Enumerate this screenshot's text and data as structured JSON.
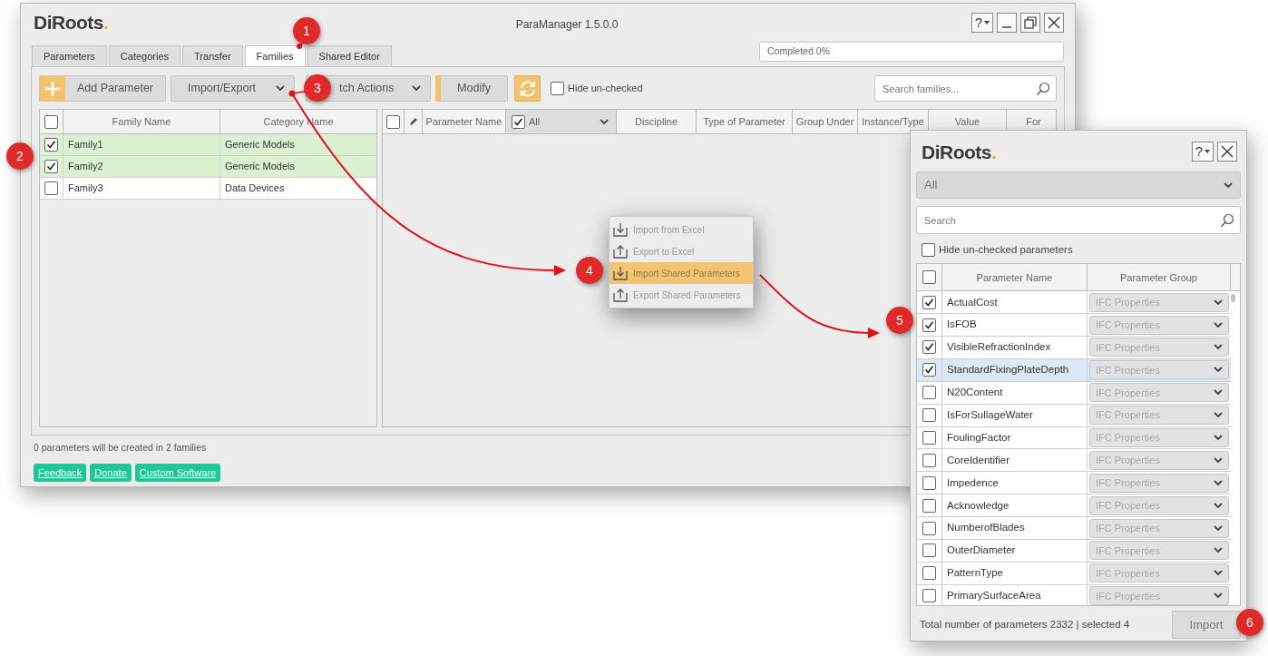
{
  "main_window": {
    "logo": "DiRoots.",
    "title": "ParaManager 1.5.0.0",
    "help_button": "?",
    "tabs": [
      {
        "label": "Parameters",
        "selected": false
      },
      {
        "label": "Categories",
        "selected": false
      },
      {
        "label": "Transfer",
        "selected": false
      },
      {
        "label": "Families",
        "selected": true
      },
      {
        "label": "Shared Editor",
        "selected": false
      }
    ],
    "progress": {
      "text": "Completed 0%",
      "level": 0
    },
    "toolbar": {
      "add_button": "Add Parameter",
      "import_export": "Import/Export",
      "batch_actions": "tch Actions",
      "modify": "Modify",
      "hide_unchecked": {
        "label": "Hide un-checked",
        "checked": false
      },
      "search": {
        "placeholder": "Search families..."
      }
    },
    "families_table": {
      "select_all": false,
      "columns": [
        "Family Name",
        "Category Name"
      ],
      "rows": [
        {
          "name": "Family1",
          "category": "Generic Models",
          "checked": true
        },
        {
          "name": "Family2",
          "category": "Generic Models",
          "checked": true
        },
        {
          "name": "Family3",
          "category": "Data Devices",
          "checked": false
        }
      ]
    },
    "parameters_table": {
      "select_all": false,
      "columns": [
        {
          "kind": "text",
          "label": "Parameter Name"
        },
        {
          "kind": "filter",
          "label": "All",
          "checked": true
        },
        {
          "kind": "text",
          "label": "Discipline"
        },
        {
          "kind": "text",
          "label": "Type of Parameter"
        },
        {
          "kind": "text",
          "label": "Group Under"
        },
        {
          "kind": "text",
          "label": "Instance/Type"
        },
        {
          "kind": "text",
          "label": "Value"
        },
        {
          "kind": "text",
          "label": "For"
        }
      ]
    },
    "status": "0 parameters will be created in 2 families",
    "links": [
      "Feedback",
      "Donate",
      "Custom Software"
    ]
  },
  "menu": {
    "items": [
      {
        "label": "Import from Excel",
        "kind": "import",
        "selected": false
      },
      {
        "label": "Export to Excel",
        "kind": "export",
        "selected": false
      },
      {
        "label": "Import Shared Parameters",
        "kind": "import",
        "selected": true
      },
      {
        "label": "Export Shared Parameters",
        "kind": "export",
        "selected": false
      }
    ]
  },
  "dialog": {
    "logo": "DiRoots.",
    "help_button": "?",
    "category": {
      "value": "All"
    },
    "search": {
      "placeholder": "Search"
    },
    "hide_unchecked": {
      "label": "Hide un-checked parameters",
      "checked": false
    },
    "table": {
      "select_all": false,
      "columns": [
        "Parameter Name",
        "Parameter Group"
      ],
      "rows": [
        {
          "name": "ActualCost",
          "group": "IFC Properties",
          "checked": true,
          "selected": false
        },
        {
          "name": "IsFOB",
          "group": "IFC Properties",
          "checked": true,
          "selected": false
        },
        {
          "name": "VisibleRefractionIndex",
          "group": "IFC Properties",
          "checked": true,
          "selected": false
        },
        {
          "name": "StandardFixingPlateDepth",
          "group": "IFC Properties",
          "checked": true,
          "selected": true
        },
        {
          "name": "N20Content",
          "group": "IFC Properties",
          "checked": false,
          "selected": false
        },
        {
          "name": "IsForSullageWater",
          "group": "IFC Properties",
          "checked": false,
          "selected": false
        },
        {
          "name": "FoulingFactor",
          "group": "IFC Properties",
          "checked": false,
          "selected": false
        },
        {
          "name": "CoreIdentifier",
          "group": "IFC Properties",
          "checked": false,
          "selected": false
        },
        {
          "name": "Impedence",
          "group": "IFC Properties",
          "checked": false,
          "selected": false
        },
        {
          "name": "Acknowledge",
          "group": "IFC Properties",
          "checked": false,
          "selected": false
        },
        {
          "name": "NumberofBlades",
          "group": "IFC Properties",
          "checked": false,
          "selected": false
        },
        {
          "name": "OuterDiameter",
          "group": "IFC Properties",
          "checked": false,
          "selected": false
        },
        {
          "name": "PatternType",
          "group": "IFC Properties",
          "checked": false,
          "selected": false
        },
        {
          "name": "PrimarySurfaceArea",
          "group": "IFC Properties",
          "checked": false,
          "selected": false
        }
      ]
    },
    "total": "Total number of parameters 2332 | selected 4",
    "import_button": "Import"
  },
  "callouts": [
    "1",
    "2",
    "3",
    "4",
    "5",
    "6"
  ]
}
